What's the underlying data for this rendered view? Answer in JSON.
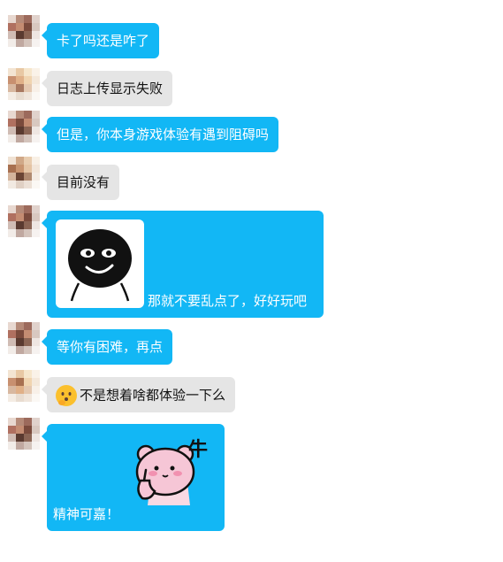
{
  "chat": {
    "messages": [
      {
        "text": "卡了吗还是咋了"
      },
      {
        "text": "日志上传显示失败"
      },
      {
        "text": "但是，你本身游戏体验有遇到阻碍吗"
      },
      {
        "text": "目前没有"
      },
      {
        "text": "那就不要乱点了，好好玩吧"
      },
      {
        "text": "等你有困难，再点"
      },
      {
        "text": "不是想着啥都体验一下么"
      },
      {
        "text": "精神可嘉！"
      }
    ]
  },
  "stickers": {
    "bear_text": "牛"
  },
  "colors": {
    "outgoing_bubble": "#12b7f5",
    "incoming_bubble": "#e5e5e5"
  },
  "icons": {
    "emoji": "thinking-face",
    "sticker1": "black-blob-smiling",
    "sticker2": "pink-bear-thumb"
  }
}
